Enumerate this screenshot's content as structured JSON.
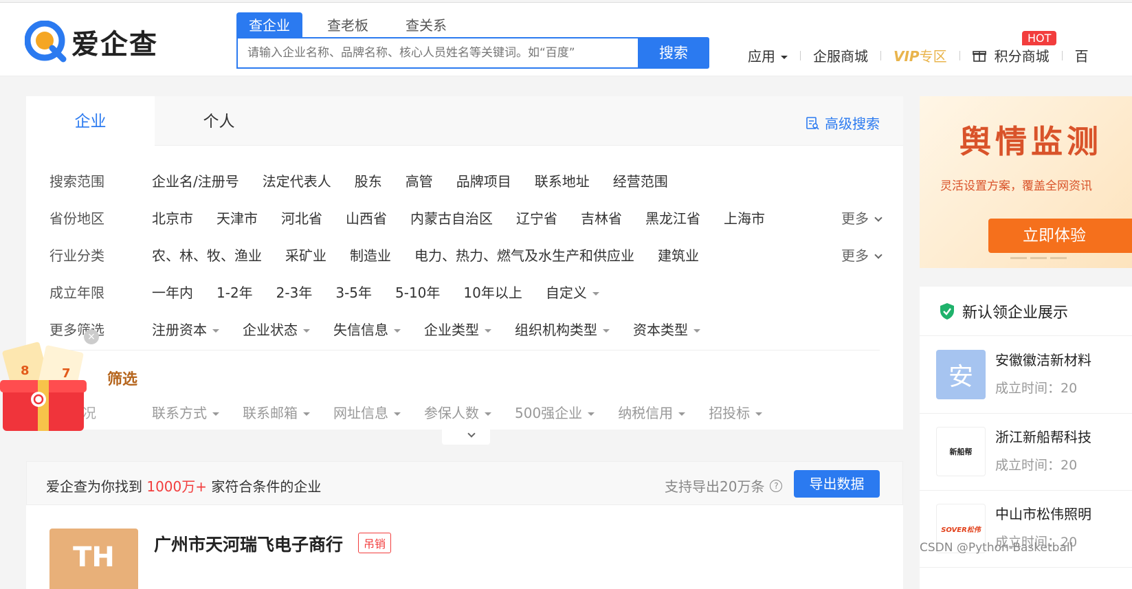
{
  "header": {
    "logo_text": "爱企查",
    "search_tabs": [
      "查企业",
      "查老板",
      "查关系"
    ],
    "search_placeholder": "请输入企业名称、品牌名称、核心人员姓名等关键词。如“百度”",
    "search_button": "搜索",
    "nav": {
      "apps": "应用",
      "mall": "企服商城",
      "vip": "VIP",
      "vip_zone": "专区",
      "points": "积分商城",
      "cut": "百",
      "hot": "HOT"
    }
  },
  "filters": {
    "tabs": [
      "企业",
      "个人"
    ],
    "advanced_search": "高级搜索",
    "rows": [
      {
        "label": "搜索范围",
        "options": [
          "企业名/注册号",
          "法定代表人",
          "股东",
          "高管",
          "品牌项目",
          "联系地址",
          "经营范围"
        ]
      },
      {
        "label": "省份地区",
        "options": [
          "北京市",
          "天津市",
          "河北省",
          "山西省",
          "内蒙古自治区",
          "辽宁省",
          "吉林省",
          "黑龙江省",
          "上海市"
        ],
        "more": "更多"
      },
      {
        "label": "行业分类",
        "options": [
          "农、林、牧、渔业",
          "采矿业",
          "制造业",
          "电力、热力、燃气及水生产和供应业",
          "建筑业"
        ],
        "more": "更多"
      },
      {
        "label": "成立年限",
        "options": [
          "一年内",
          "1-2年",
          "2-3年",
          "3-5年",
          "5-10年",
          "10年以上",
          "自定义"
        ]
      },
      {
        "label": "更多筛选",
        "options": [
          "注册资本",
          "企业状态",
          "失信信息",
          "企业类型",
          "组织机构类型",
          "资本类型"
        ]
      }
    ],
    "premium_title": "筛选",
    "premium_label": "况",
    "premium_options": [
      "联系方式",
      "联系邮箱",
      "网址信息",
      "参保人数",
      "500强企业",
      "纳税信用",
      "招投标"
    ]
  },
  "results": {
    "prefix": "爱企查为你找到",
    "count": "1000万+",
    "suffix": "家符合条件的企业",
    "export_note": "支持导出20万条",
    "export_button": "导出数据",
    "first_company": {
      "logo_text": "TH",
      "name": "广州市天河瑞飞电子商行",
      "status": "吊销"
    }
  },
  "sidebar": {
    "ad_title": "舆情监测",
    "ad_subtitle": "灵活设置方案，覆盖全网资讯",
    "ad_button": "立即体验",
    "claim_title": "新认领企业展示",
    "claim_items": [
      {
        "logo": "安",
        "name": "安徽徽洁新材料",
        "time": "成立时间：20"
      },
      {
        "logo": "新船帮",
        "name": "浙江新船帮科技",
        "time": "成立时间：20"
      },
      {
        "logo": "SOVER松伟",
        "name": "中山市松伟照明",
        "time": "成立时间：20"
      }
    ]
  },
  "watermark": "CSDN @Python-Basketball",
  "colors": {
    "primary": "#2b7af0",
    "danger": "#f23d3d",
    "vip": "#e9b44c",
    "ad": "#d9532a"
  }
}
